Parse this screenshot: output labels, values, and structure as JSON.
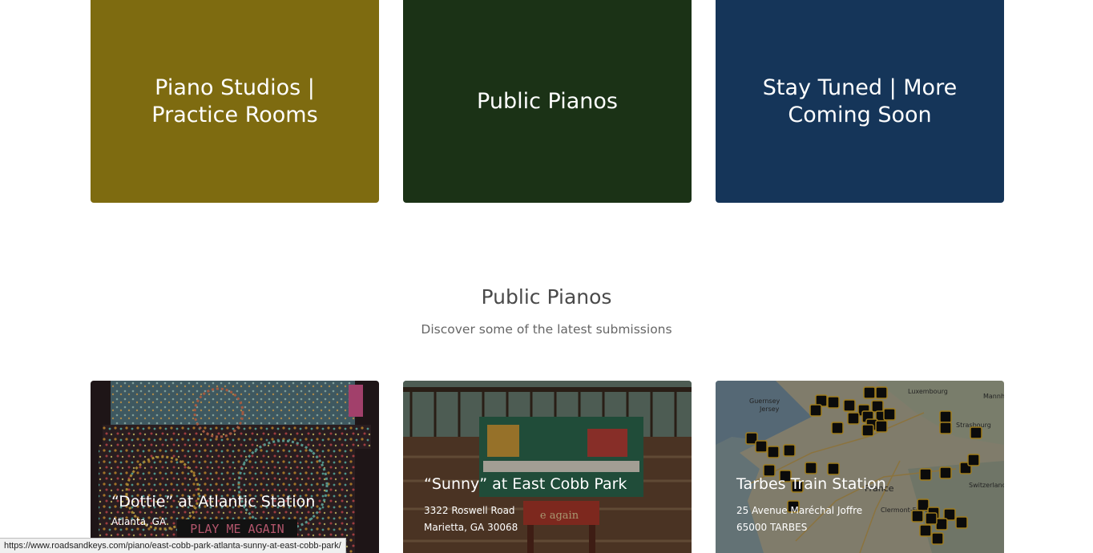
{
  "categories": [
    {
      "label": "Piano Studios | Practice Rooms",
      "color": "#7e6b10"
    },
    {
      "label": "Public Pianos",
      "color": "#1b3216"
    },
    {
      "label": "Stay Tuned | More Coming Soon",
      "color": "#153559"
    }
  ],
  "section": {
    "title": "Public Pianos",
    "subtitle": "Discover some of the latest submissions"
  },
  "pianos": [
    {
      "title": "“Dottie” at Atlantic Station",
      "line1": "Atlanta, GA",
      "line2": "",
      "photo_text": "PLAY ME AGAIN"
    },
    {
      "title": "“Sunny” at East Cobb Park",
      "line1": "3322 Roswell Road",
      "line2": "Marietta, GA 30068",
      "photo_text": "e again"
    },
    {
      "title": "Tarbes Train Station",
      "line1": "25 Avenue Maréchal Joffre",
      "line2": "65000 TARBES"
    }
  ],
  "map_labels": [
    "Guernsey",
    "Jersey",
    "Luxembourg",
    "Mannh",
    "Strasbourg",
    "Switzerland",
    "France",
    "Clermont-Ferrand"
  ],
  "status_bar": {
    "url": "https://www.roadsandkeys.com/piano/east-cobb-park-atlanta-sunny-at-east-cobb-park/"
  }
}
